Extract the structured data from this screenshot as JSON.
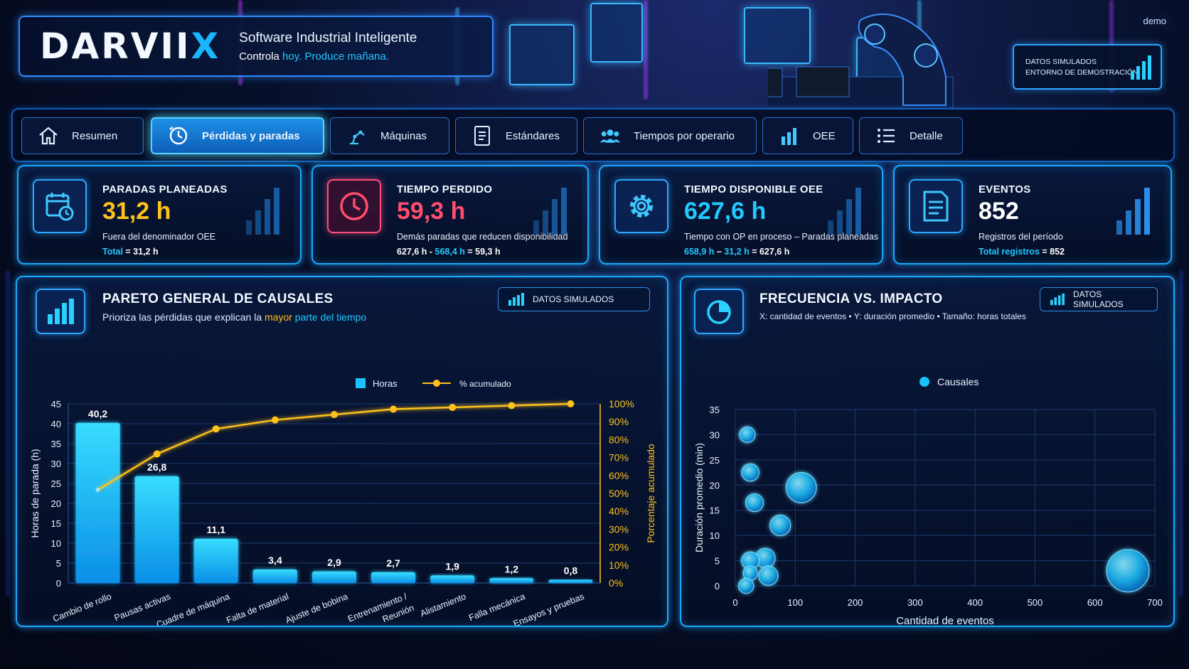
{
  "header": {
    "logo_main": "DARVII",
    "logo_accent": "X",
    "title": "Software Industrial Inteligente",
    "tagline_a": "Controla ",
    "tagline_b": "hoy. Produce mañana.",
    "demo_badge": "demo",
    "sim_line1": "DATOS SIMULADOS",
    "sim_line2": "ENTORNO DE DEMOSTRACIÓN"
  },
  "tabs": [
    {
      "label": "Resumen",
      "icon": "home-icon"
    },
    {
      "label": "Pérdidas y paradas",
      "icon": "clock-icon",
      "active": true
    },
    {
      "label": "Máquinas",
      "icon": "robot-arm-icon"
    },
    {
      "label": "Estándares",
      "icon": "document-icon"
    },
    {
      "label": "Tiempos por operario",
      "icon": "users-icon"
    },
    {
      "label": "OEE",
      "icon": "bar-chart-icon"
    },
    {
      "label": "Detalle",
      "icon": "list-icon"
    }
  ],
  "kpis": [
    {
      "title": "PARADAS PLANEADAS",
      "value": "31,2 h",
      "color": "#ffc21a",
      "sub": "Fuera del denominador OEE",
      "foot_a": "Total",
      "foot_b": " = 31,2 h"
    },
    {
      "title": "TIEMPO PERDIDO",
      "value": "59,3 h",
      "color": "#ff4d6d",
      "sub": "Demás paradas que reducen disponibilidad",
      "foot_a": "627,6 h",
      "foot_b": " - ",
      "foot_c": "568,4 h",
      "foot_d": " = 59,3 h"
    },
    {
      "title": "TIEMPO DISPONIBLE OEE",
      "value": "627,6 h",
      "color": "#23c8ff",
      "sub": "Tiempo con OP en proceso – Paradas planeadas",
      "foot_a": "658,9 h",
      "foot_b": " – ",
      "foot_c": "31,2 h",
      "foot_d": " = 627,6 h"
    },
    {
      "title": "EVENTOS",
      "value": "852",
      "color": "#ffffff",
      "sub": "Registros del período",
      "foot_a": "Total registros",
      "foot_b": " = 852"
    }
  ],
  "pareto": {
    "title": "PARETO GENERAL DE CAUSALES",
    "subtitle_a": "Prioriza las pérdidas que explican la ",
    "subtitle_b": "mayor",
    "subtitle_c": " parte del tiempo",
    "badge": "DATOS SIMULADOS"
  },
  "bubble": {
    "title": "FRECUENCIA VS. IMPACTO",
    "subtitle": "X: cantidad de eventos   •   Y: duración promedio   •   Tamaño: horas totales",
    "badge": "DATOS SIMULADOS"
  },
  "colors": {
    "accent": "#1aa8ff",
    "bar": "#19c3ff",
    "line": "#ffc21a",
    "panel": "#07163a"
  },
  "chart_data": [
    {
      "type": "bar",
      "categories": [
        "Cambio de rollo",
        "Pausas activas",
        "Cuadre de máquina",
        "Falta de material",
        "Ajuste de bobina",
        "Entrenamiento / Reunión",
        "Alistamiento",
        "Falla mecánica",
        "Ensayos y pruebas"
      ],
      "series": [
        {
          "name": "Horas",
          "values": [
            40.2,
            26.8,
            11.1,
            3.4,
            2.9,
            2.7,
            1.9,
            1.2,
            0.8
          ]
        },
        {
          "name": "% acumulado",
          "values": [
            52,
            72,
            86,
            91,
            94,
            97,
            98,
            99,
            100
          ]
        }
      ],
      "value_labels": [
        "40,2",
        "26,8",
        "11,1",
        "3,4",
        "2,9",
        "2,7",
        "1,9",
        "1,2",
        "0,8"
      ],
      "ylabel": "Horas de parada (h)",
      "y2label": "Porcentaje acumulado",
      "ylim": [
        0,
        45
      ],
      "yticks": [
        0,
        5,
        10,
        15,
        20,
        25,
        30,
        35,
        40,
        45
      ],
      "y2ticks": [
        "0%",
        "10%",
        "20%",
        "30%",
        "40%",
        "50%",
        "60%",
        "70%",
        "80%",
        "90%",
        "100%"
      ],
      "grid": true,
      "legend": "top-center"
    },
    {
      "type": "scatter",
      "series": [
        {
          "name": "Causales",
          "points": [
            {
              "x": 20,
              "y": 30,
              "size": 1.2
            },
            {
              "x": 25,
              "y": 22.5,
              "size": 1.8
            },
            {
              "x": 32,
              "y": 16.5,
              "size": 2.0
            },
            {
              "x": 110,
              "y": 19.5,
              "size": 11.1
            },
            {
              "x": 75,
              "y": 12,
              "size": 3.4
            },
            {
              "x": 50,
              "y": 5.5,
              "size": 2.9
            },
            {
              "x": 25,
              "y": 5,
              "size": 1.9
            },
            {
              "x": 55,
              "y": 2,
              "size": 2.7
            },
            {
              "x": 25,
              "y": 2.5,
              "size": 0.8
            },
            {
              "x": 18,
              "y": 0,
              "size": 1.0
            },
            {
              "x": 655,
              "y": 3,
              "size": 26.8
            }
          ]
        }
      ],
      "xlabel": "Cantidad de eventos",
      "ylabel": "Duración promedio (min)",
      "xlim": [
        0,
        700
      ],
      "ylim": [
        0,
        35
      ],
      "xticks": [
        0,
        100,
        200,
        300,
        400,
        500,
        600,
        700
      ],
      "yticks": [
        0,
        5,
        10,
        15,
        20,
        25,
        30,
        35
      ],
      "grid": true,
      "legend": "top-center"
    }
  ]
}
